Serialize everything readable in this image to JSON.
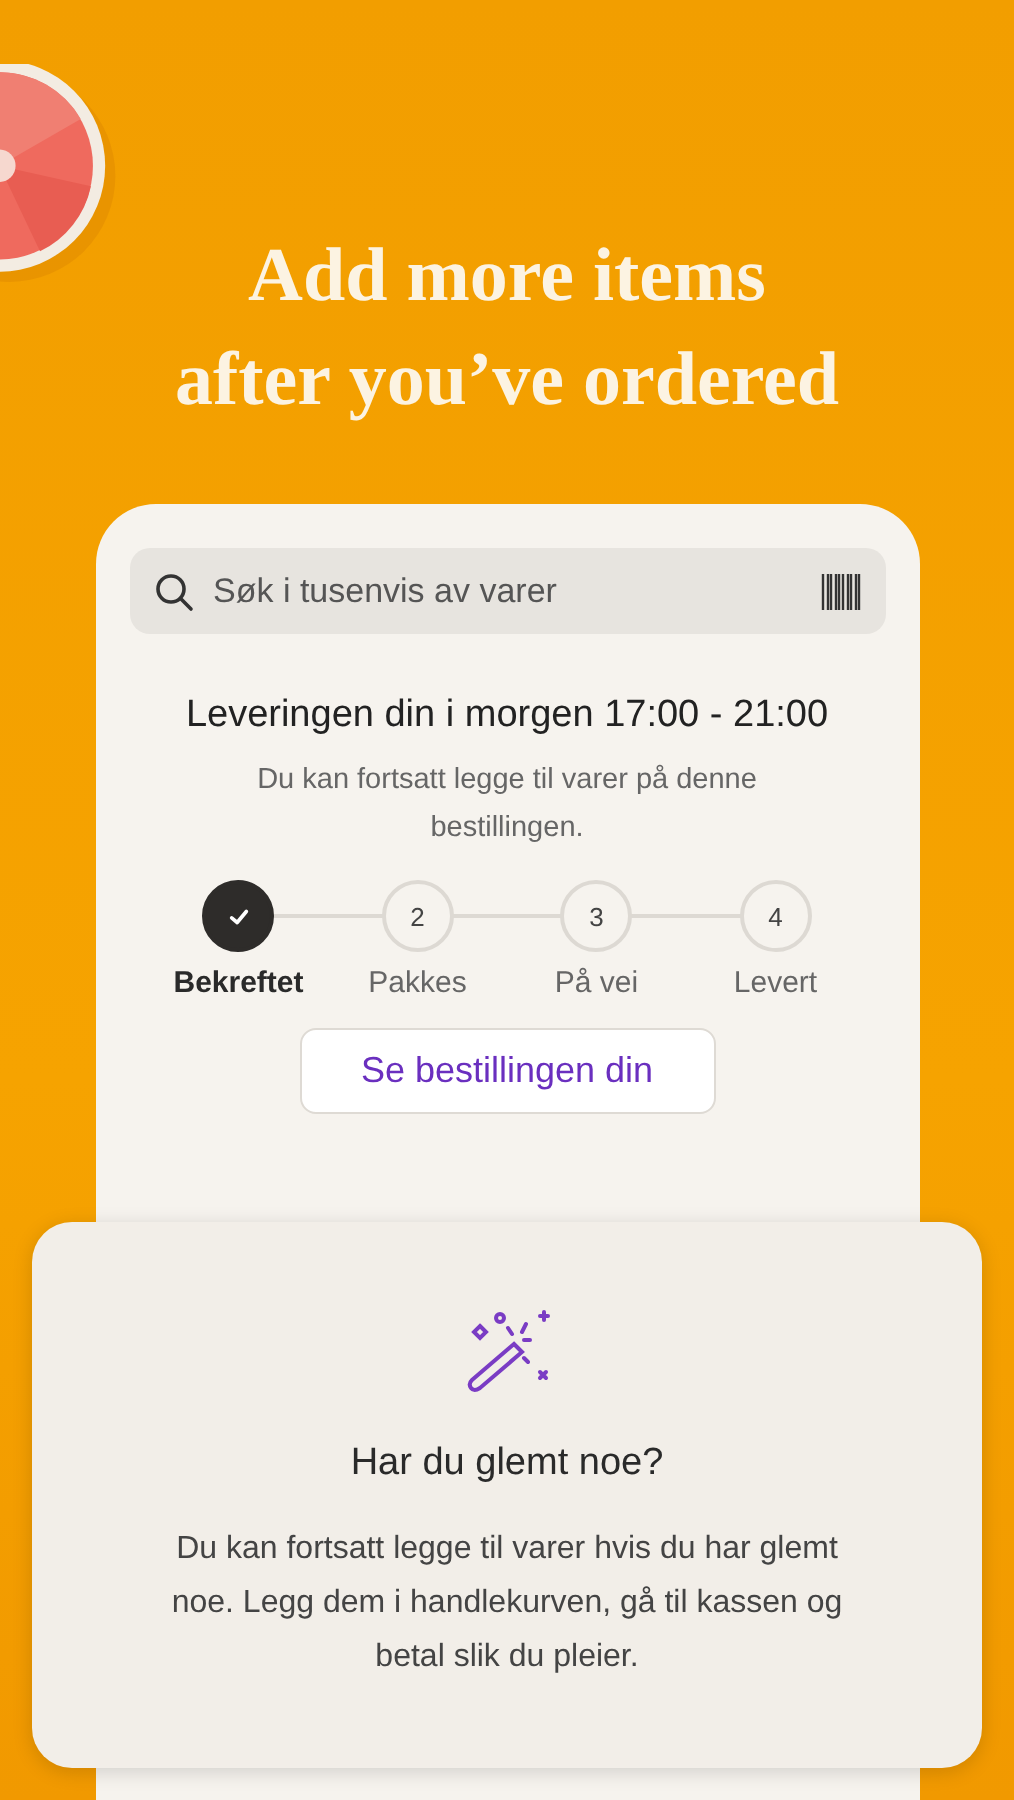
{
  "headline": [
    "Add more items",
    "after you’ve ordered"
  ],
  "search": {
    "placeholder": "Søk i tusenvis av varer"
  },
  "delivery": {
    "title": "Leveringen din i morgen 17:00 - 21:00",
    "subtitle": "Du kan fortsatt legge til varer på denne bestillingen."
  },
  "steps": [
    {
      "label": "Bekreftet",
      "done": true
    },
    {
      "label": "Pakkes",
      "number": "2",
      "done": false
    },
    {
      "label": "På vei",
      "number": "3",
      "done": false
    },
    {
      "label": "Levert",
      "number": "4",
      "done": false
    }
  ],
  "order_button": "Se bestillingen din",
  "popup": {
    "title": "Har du glemt noe?",
    "body": "Du kan fortsatt legge til varer hvis du har glemt noe. Legg dem i handlekurven, gå til kassen og betal slik du pleier."
  }
}
